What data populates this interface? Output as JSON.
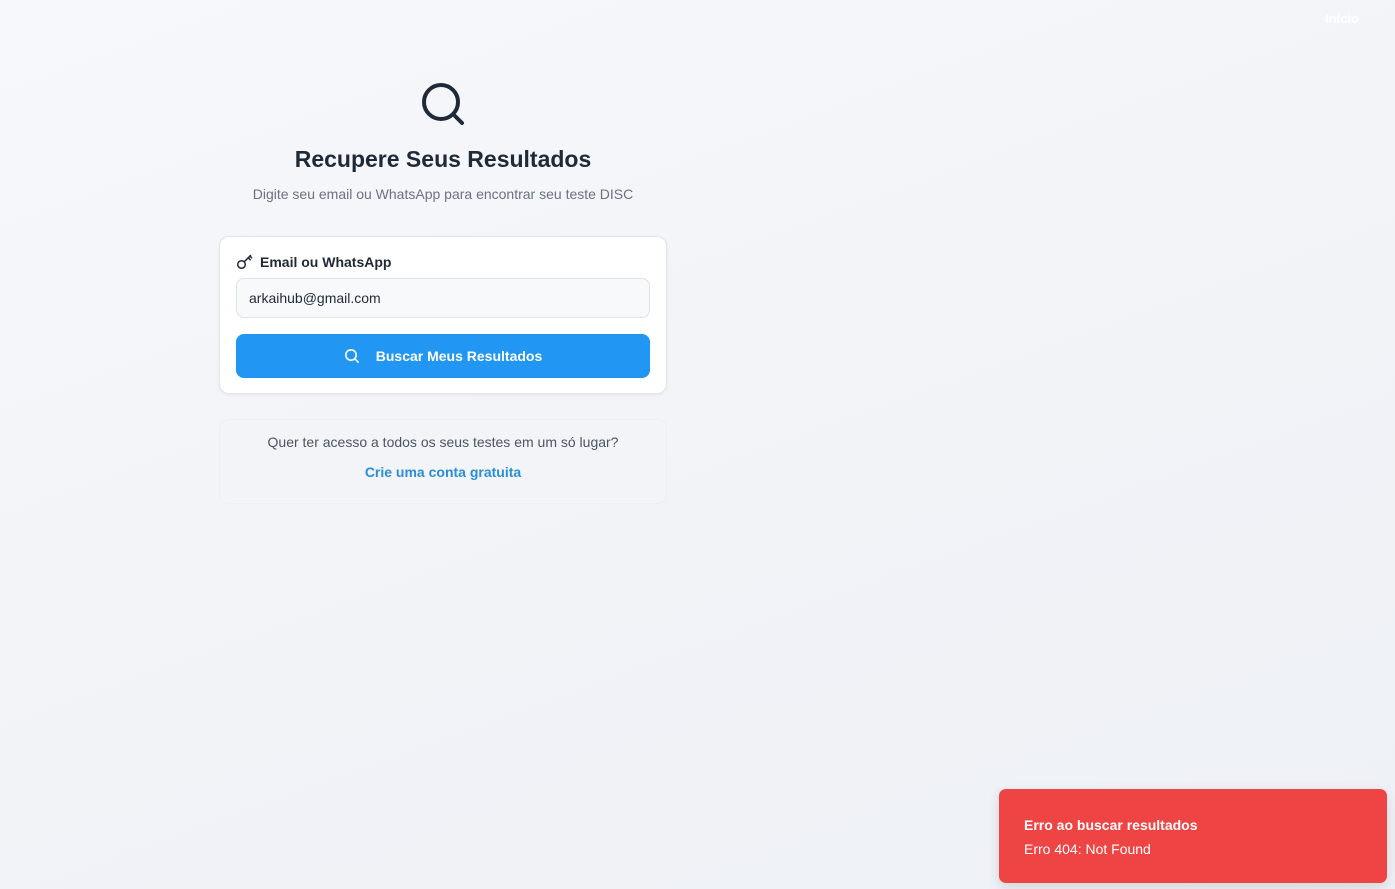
{
  "nav": {
    "home_label": "Início"
  },
  "header": {
    "icon": "search-icon",
    "title": "Recupere Seus Resultados",
    "subtitle": "Digite seu email ou WhatsApp para encontrar seu teste DISC"
  },
  "form": {
    "label_icon": "key-icon",
    "label": "Email ou WhatsApp",
    "input_value": "arkaihub@gmail.com",
    "submit_icon": "search-icon",
    "submit_label": "Buscar Meus Resultados"
  },
  "signup": {
    "prompt": "Quer ter acesso a todos os seus testes em um só lugar?",
    "link_label": "Crie uma conta gratuita"
  },
  "toast": {
    "title": "Erro ao buscar resultados",
    "description": "Erro 404: Not Found"
  },
  "colors": {
    "primary": "#2196f3",
    "link": "#2a8fd6",
    "error": "#ef4444"
  }
}
